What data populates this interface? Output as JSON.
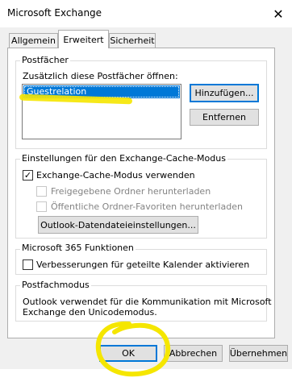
{
  "window": {
    "title": "Microsoft Exchange",
    "close_glyph": "✕"
  },
  "tabs": [
    {
      "label": "Allgemein",
      "active": false
    },
    {
      "label": "Erweitert",
      "active": true
    },
    {
      "label": "Sicherheit",
      "active": false
    }
  ],
  "mailboxes": {
    "group_label": "Postfächer",
    "open_label": "Zusätzlich diese Postfächer öffnen:",
    "items": [
      "Guestrelation"
    ],
    "add_button": "Hinzufügen...",
    "remove_button": "Entfernen"
  },
  "cache": {
    "group_label": "Einstellungen für den Exchange-Cache-Modus",
    "use_cache": {
      "label": "Exchange-Cache-Modus verwenden",
      "checked": true
    },
    "download_shared": {
      "label": "Freigegebene Ordner herunterladen",
      "checked": false,
      "enabled": false
    },
    "download_favorites": {
      "label": "Öffentliche Ordner-Favoriten herunterladen",
      "checked": false,
      "enabled": false
    },
    "datafile_button": "Outlook-Datendateieinstellungen..."
  },
  "m365": {
    "group_label": "Microsoft 365 Funktionen",
    "calendar": {
      "label": "Verbesserungen für geteilte Kalender aktivieren",
      "checked": false
    }
  },
  "mailbox_mode": {
    "group_label": "Postfachmodus",
    "line1": "Outlook verwendet für die Kommunikation mit Microsoft",
    "line2": "Exchange den Unicodemodus."
  },
  "footer": {
    "ok": "OK",
    "cancel": "Abbrechen",
    "apply": "Übernehmen"
  },
  "colors": {
    "selection": "#0078d7",
    "annotation": "#f5e600"
  },
  "icons": {
    "check": "✓"
  }
}
